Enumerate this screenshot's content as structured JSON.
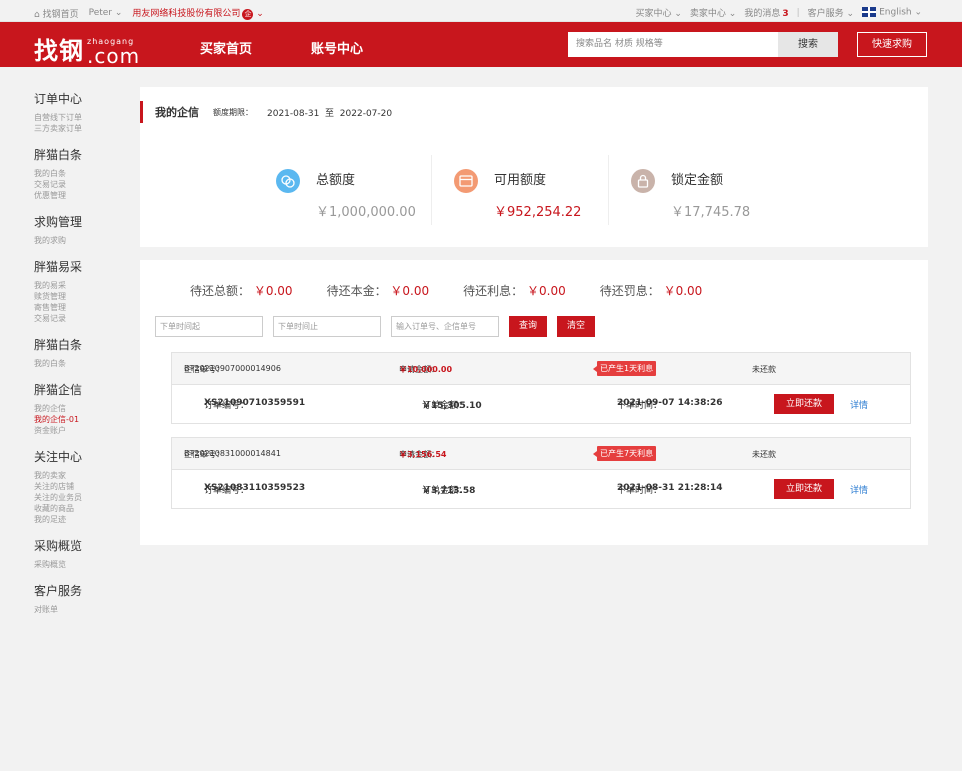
{
  "topbar": {
    "home": "找钢首页",
    "user": "Peter",
    "company": "用友网络科技股份有限公司",
    "company_badge": "企",
    "buyer_center": "买家中心",
    "seller_center": "卖家中心",
    "messages_label": "我的消息",
    "messages_count": "3",
    "customer_service": "客户服务",
    "language": "English"
  },
  "header": {
    "logo_main": "找钢",
    "logo_pinyin": "zhaogang",
    "logo_domain": ".com",
    "nav": [
      "买家首页",
      "账号中心"
    ],
    "search_placeholder": "搜索品名 材质 规格等",
    "search_button": "搜索",
    "quick_buy": "快速求购"
  },
  "sidebar": [
    {
      "title": "订单中心",
      "links": [
        "自营线下订单",
        "三方卖家订单"
      ]
    },
    {
      "title": "胖猫白条",
      "links": [
        "我的白条",
        "交易记录",
        "优惠管理"
      ]
    },
    {
      "title": "求购管理",
      "links": [
        "我的求购"
      ]
    },
    {
      "title": "胖猫易采",
      "links": [
        "我的易采",
        "赎货管理",
        "寄售管理",
        "交易记录"
      ]
    },
    {
      "title": "胖猫白条",
      "links": [
        "我的白条"
      ]
    },
    {
      "title": "胖猫企信",
      "links": [
        "我的企信",
        "我的企信-01",
        "资金账户"
      ]
    },
    {
      "title": "关注中心",
      "links": [
        "我的卖家",
        "关注的店铺",
        "关注的业务员",
        "收藏的商品",
        "我的足迹"
      ]
    },
    {
      "title": "采购概览",
      "links": [
        "采购概览"
      ]
    },
    {
      "title": "客户服务",
      "links": [
        "对账单"
      ]
    }
  ],
  "sidebar_active": "我的企信-01",
  "credit": {
    "title": "我的企信",
    "period_label": "额度期限：",
    "period_start": "2021-08-31",
    "period_sep": "至",
    "period_end": "2022-07-20",
    "stats": [
      {
        "label": "总额度",
        "value": "￥1,000,000.00",
        "icon": "coin-icon",
        "color": "#5bb8f0"
      },
      {
        "label": "可用额度",
        "value": "￥952,254.22",
        "icon": "card-icon",
        "color": "#f39a73"
      },
      {
        "label": "锁定金额",
        "value": "￥17,745.78",
        "icon": "lock-icon",
        "color": "#c9b3aa"
      }
    ]
  },
  "summary": [
    {
      "label": "待还总额：",
      "amount": "￥0.00"
    },
    {
      "label": "待还本金：",
      "amount": "￥0.00"
    },
    {
      "label": "待还利息：",
      "amount": "￥0.00"
    },
    {
      "label": "待还罚息：",
      "amount": "￥0.00"
    }
  ],
  "filter": {
    "start_placeholder": "下单时间起",
    "end_placeholder": "下单时间止",
    "order_placeholder": "输入订单号、企信单号",
    "query_button": "查询",
    "clear_button": "清空"
  },
  "orders": [
    {
      "credit_no_label": "企信单号：",
      "credit_no": "BT20210907000014906",
      "apply_label": "申请金额：",
      "apply_amount": "￥10,000.00",
      "interest_tag": "已产生1天利息",
      "status": "未还款",
      "order_no_label": "订单编号：",
      "order_no": "XS21090710359591",
      "order_amount_label": "订单金额：",
      "order_amount": "￥15,305.10",
      "order_time_label": "下单时间：",
      "order_time": "2021-09-07 14:38:26",
      "repay_button": "立即还款",
      "detail_link": "详情"
    },
    {
      "credit_no_label": "企信单号：",
      "credit_no": "BT20210831000014841",
      "apply_label": "申请金额：",
      "apply_amount": "￥3,156.54",
      "interest_tag": "已产生7天利息",
      "status": "未还款",
      "order_no_label": "订单编号：",
      "order_no": "XS21083110359523",
      "order_amount_label": "订单金额：",
      "order_amount": "￥3,713.58",
      "order_time_label": "下单时间：",
      "order_time": "2021-08-31 21:28:14",
      "repay_button": "立即还款",
      "detail_link": "详情"
    }
  ]
}
